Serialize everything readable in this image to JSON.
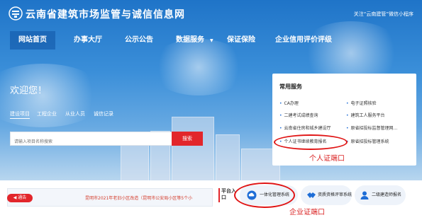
{
  "header": {
    "site_title": "云南省建筑市场监管与诚信信息网",
    "top_right_text": "关注“云南建管”微信小程序"
  },
  "nav": {
    "items": [
      "网站首页",
      "办事大厅",
      "公示公告",
      "数据服务",
      "保证保险",
      "企业信用评价评级"
    ]
  },
  "welcome": "欢迎您！",
  "tabs": [
    "建设项目",
    "工程企业",
    "从业人员",
    "诚信记录"
  ],
  "search": {
    "placeholder": "请输入项目名称搜索",
    "button_label": "搜索"
  },
  "services": {
    "title": "常用服务",
    "items": [
      "CA办理",
      "电子证照核验",
      "二建考试成绩查询",
      "建筑工人服务平台",
      "云南省住房和城乡建设厅",
      "原省招投标监督管理网...",
      "个人证书继续教育报名",
      "原省招投标管理系统"
    ]
  },
  "notice": {
    "badge": "通告",
    "text": "昆明市2021年老旧小区改造（昆明市公安局小区等5个小"
  },
  "platform": {
    "label": "平台入口",
    "buttons": [
      "一体化管理系统",
      "资质资格评审系统",
      "二级建造师报名"
    ]
  },
  "annotations": {
    "personal": "个人证端口",
    "enterprise": "企业证端口"
  },
  "colors": {
    "primary_blue": "#1f74c8",
    "accent_red": "#e2262b",
    "annotation_red": "#e01414"
  }
}
